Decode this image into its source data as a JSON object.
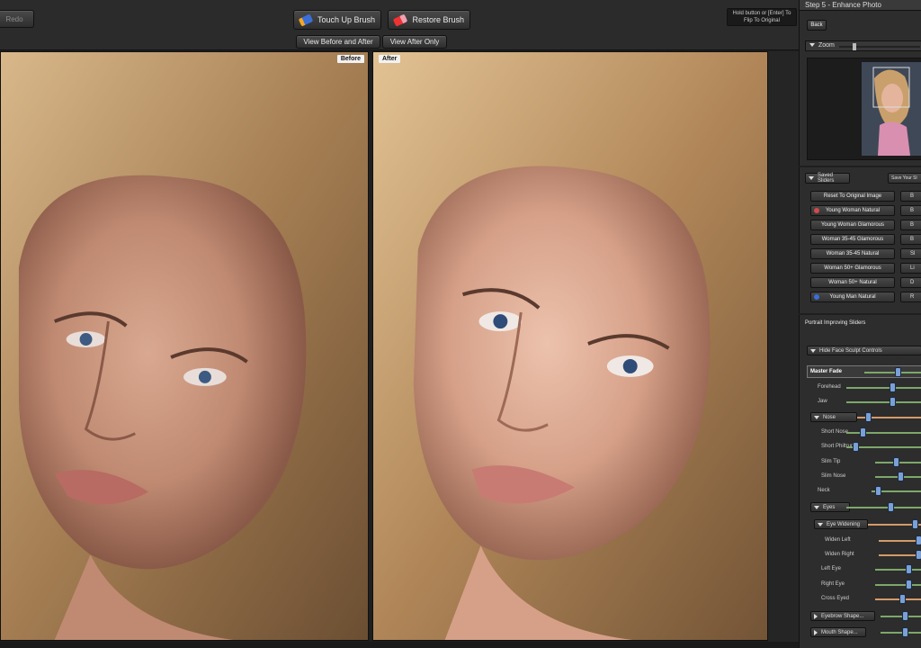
{
  "toolbar": {
    "redo_label": "Redo",
    "touch_up_label": "Touch Up Brush",
    "restore_label": "Restore Brush",
    "view_before_after_label": "View Before and After",
    "view_after_only_label": "View After Only",
    "hold_button_text": "Hold button or [Enter] To Flip To Original"
  },
  "photos": {
    "before_label": "Before",
    "after_label": "After"
  },
  "step_panel": {
    "title": "Step 5 - Enhance Photo",
    "back_label": "Back",
    "zoom_label": "Zoom",
    "zoom_level": 0.17
  },
  "saved_panel": {
    "header_label": "Saved Sliders",
    "save_your_label": "Save Your Sl",
    "presets": [
      "Reset To Original Image",
      "Young Woman Natural",
      "Young Woman Glamorous",
      "Woman 35-45 Glamorous",
      "Woman 35-45 Natural",
      "Woman 50+ Glamorous",
      "Woman 50+ Natural",
      "Young Man Natural"
    ],
    "right_column": [
      "B",
      "B",
      "B",
      "B",
      "Sl",
      "Li",
      "D",
      "R"
    ]
  },
  "portrait_panel": {
    "title": "Portrait Improving Sliders",
    "hide_face_label": "Hide Face Sculpt Controls",
    "sliders": [
      {
        "label": "Master Fade",
        "value": 0.6
      },
      {
        "label": "Forehead",
        "value": 0.62
      },
      {
        "label": "Jaw",
        "value": 0.62
      },
      {
        "label": "Nose",
        "value": 0.15
      },
      {
        "label": "Short Nose",
        "value": 0.2
      },
      {
        "label": "Short Philtrum",
        "value": 0.1
      },
      {
        "label": "Slim Tip",
        "value": 0.45
      },
      {
        "label": "Slim Nose",
        "value": 0.55
      },
      {
        "label": "Neck",
        "value": 0.1
      },
      {
        "label": "Eyes",
        "value": 0.6
      },
      {
        "label": "Eye Widening",
        "value": 0.9
      },
      {
        "label": "Widen Left",
        "value": 0.97
      },
      {
        "label": "Widen Right",
        "value": 0.97
      },
      {
        "label": "Left Eye",
        "value": 0.75
      },
      {
        "label": "Right Eye",
        "value": 0.75
      },
      {
        "label": "Cross Eyed",
        "value": 0.6
      },
      {
        "label": "Eyebrow Shape...",
        "value": 0.6
      },
      {
        "label": "Mouth Shape...",
        "value": 0.6
      }
    ]
  }
}
